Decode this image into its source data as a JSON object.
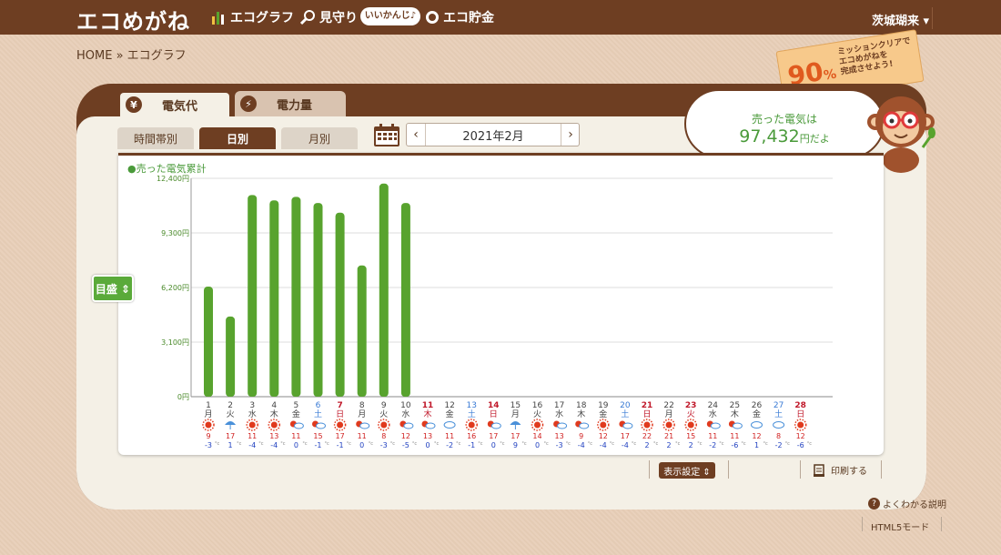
{
  "header": {
    "logo": "エコめがね",
    "nav": [
      {
        "label": "エコグラフ",
        "icon": "bar-chart-icon"
      },
      {
        "label": "見守り",
        "icon": "magnifier-icon"
      },
      {
        "label": "エコ貯金",
        "icon": "piggy-bank-icon"
      }
    ],
    "nav_bubble": "いいかんじ♪",
    "user": "茨城瑚来 ▾"
  },
  "breadcrumb": "HOME » エコグラフ",
  "mission": {
    "percent": "90",
    "percent_unit": "%",
    "text": "ミッションクリアで\nエコめがねを\n完成させよう!"
  },
  "tabs": [
    {
      "label": "電気代",
      "icon": "yen-icon",
      "active": true
    },
    {
      "label": "電力量",
      "icon": "bolt-icon",
      "active": false
    }
  ],
  "subtabs": [
    {
      "label": "時間帯別",
      "active": false
    },
    {
      "label": "日別",
      "active": true
    },
    {
      "label": "月別",
      "active": false
    }
  ],
  "month_picker": {
    "prev": "‹",
    "label": "2021年2月",
    "next": "›"
  },
  "bubble": {
    "line1": "売った電気は",
    "amount": "97,432",
    "suffix": "円だよ"
  },
  "meter_button": "目盛 ⇕",
  "bottom": {
    "display_settings": "表示設定 ⇕",
    "print": "印刷する",
    "help": "よくわかる説明",
    "html5": "HTML5モード"
  },
  "colors": {
    "brown": "#6e3e22",
    "green": "#58a32e",
    "saturday": "#3a7bd5",
    "holiday": "#c0182a"
  },
  "chart_data": {
    "type": "bar",
    "legend": "●売った電気累計",
    "yticks": [
      "0円",
      "3,100円",
      "6,200円",
      "9,300円",
      "12,400円"
    ],
    "ylim": [
      0,
      12400
    ],
    "days": [
      {
        "d": "1",
        "w": "月",
        "weather": "sun-icon",
        "hi": "9",
        "lo": "-3",
        "v": 6250
      },
      {
        "d": "2",
        "w": "火",
        "weather": "umbrella-icon",
        "hi": "17",
        "lo": "1",
        "v": 4550
      },
      {
        "d": "3",
        "w": "水",
        "weather": "sun-icon",
        "hi": "11",
        "lo": "-4",
        "v": 11450
      },
      {
        "d": "4",
        "w": "木",
        "weather": "sun-icon",
        "hi": "13",
        "lo": "-4",
        "v": 11150
      },
      {
        "d": "5",
        "w": "金",
        "weather": "sun-cloud-icon",
        "hi": "11",
        "lo": "0",
        "v": 11350
      },
      {
        "d": "6",
        "w": "土",
        "weather": "sun-cloud-icon",
        "hi": "15",
        "lo": "-1",
        "v": 11000,
        "cls": "sat"
      },
      {
        "d": "7",
        "w": "日",
        "weather": "sun-icon",
        "hi": "17",
        "lo": "-1",
        "v": 10450,
        "cls": "hol"
      },
      {
        "d": "8",
        "w": "月",
        "weather": "cloud-sun-icon",
        "hi": "11",
        "lo": "0",
        "v": 7450
      },
      {
        "d": "9",
        "w": "火",
        "weather": "sun-icon",
        "hi": "8",
        "lo": "-3",
        "v": 12100
      },
      {
        "d": "10",
        "w": "水",
        "weather": "sun-cloud-icon",
        "hi": "12",
        "lo": "-5",
        "v": 11000
      },
      {
        "d": "11",
        "w": "木",
        "weather": "sun-cloud-icon",
        "hi": "13",
        "lo": "0",
        "cls": "hol"
      },
      {
        "d": "12",
        "w": "金",
        "weather": "cloud-icon",
        "hi": "11",
        "lo": "-2"
      },
      {
        "d": "13",
        "w": "土",
        "weather": "sun-icon",
        "hi": "16",
        "lo": "-1",
        "cls": "sat"
      },
      {
        "d": "14",
        "w": "日",
        "weather": "cloud-sun-icon",
        "hi": "17",
        "lo": "0",
        "cls": "hol"
      },
      {
        "d": "15",
        "w": "月",
        "weather": "umbrella-icon",
        "hi": "17",
        "lo": "9"
      },
      {
        "d": "16",
        "w": "火",
        "weather": "sun-icon",
        "hi": "14",
        "lo": "0"
      },
      {
        "d": "17",
        "w": "水",
        "weather": "sun-cloud-icon",
        "hi": "13",
        "lo": "-3"
      },
      {
        "d": "18",
        "w": "木",
        "weather": "sun-cloud-icon",
        "hi": "9",
        "lo": "-4"
      },
      {
        "d": "19",
        "w": "金",
        "weather": "sun-icon",
        "hi": "12",
        "lo": "-4"
      },
      {
        "d": "20",
        "w": "土",
        "weather": "sun-cloud-icon",
        "hi": "17",
        "lo": "-4",
        "cls": "sat"
      },
      {
        "d": "21",
        "w": "日",
        "weather": "sun-icon",
        "hi": "22",
        "lo": "2",
        "cls": "hol"
      },
      {
        "d": "22",
        "w": "月",
        "weather": "sun-icon",
        "hi": "21",
        "lo": "2"
      },
      {
        "d": "23",
        "w": "火",
        "weather": "sun-icon",
        "hi": "15",
        "lo": "2",
        "cls": "hol"
      },
      {
        "d": "24",
        "w": "水",
        "weather": "cloud-sun-icon",
        "hi": "11",
        "lo": "-2"
      },
      {
        "d": "25",
        "w": "木",
        "weather": "sun-cloud-icon",
        "hi": "11",
        "lo": "-6"
      },
      {
        "d": "26",
        "w": "金",
        "weather": "cloud-icon",
        "hi": "12",
        "lo": "1"
      },
      {
        "d": "27",
        "w": "土",
        "weather": "cloud-icon",
        "hi": "8",
        "lo": "-2",
        "cls": "sat"
      },
      {
        "d": "28",
        "w": "日",
        "weather": "sun-icon",
        "hi": "12",
        "lo": "-6",
        "cls": "hol"
      }
    ],
    "temp_unit": "°c"
  }
}
